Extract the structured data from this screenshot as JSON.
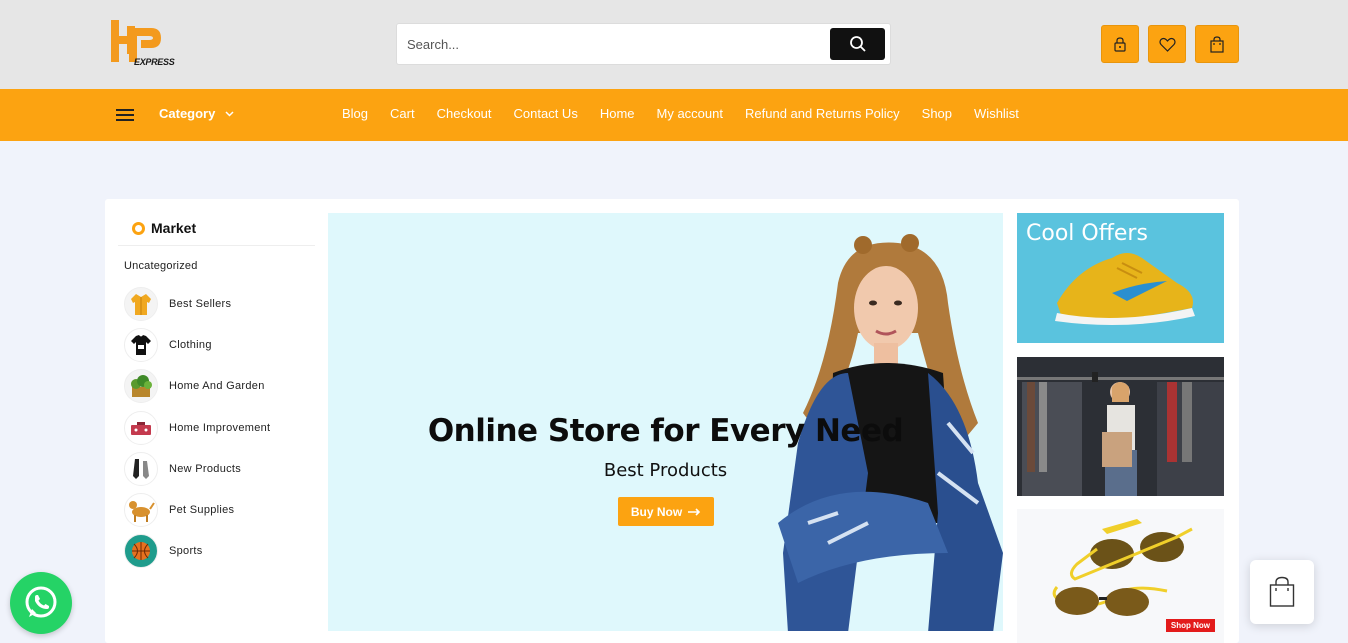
{
  "header": {
    "logo_text": "EXPRESS",
    "search": {
      "placeholder": "Search..."
    },
    "icons": [
      "lock-icon",
      "heart-icon",
      "bag-icon"
    ]
  },
  "nav": {
    "category_label": "Category",
    "menu": [
      "Blog",
      "Cart",
      "Checkout",
      "Contact Us",
      "Home",
      "My account",
      "Refund and Returns Policy",
      "Shop",
      "Wishlist"
    ]
  },
  "sidebar": {
    "title": "Market",
    "uncategorized": "Uncategorized",
    "items": [
      {
        "label": "Best Sellers"
      },
      {
        "label": "Clothing"
      },
      {
        "label": "Home And Garden"
      },
      {
        "label": "Home Improvement"
      },
      {
        "label": "New Products"
      },
      {
        "label": "Pet Supplies"
      },
      {
        "label": "Sports"
      }
    ]
  },
  "hero": {
    "title": "Online Store for Every Need",
    "subtitle": "Best Products",
    "button": "Buy Now"
  },
  "offers": {
    "cool_offers": "Cool Offers",
    "shop_now": "Shop Now"
  },
  "colors": {
    "accent": "#fca311",
    "dark": "#111111",
    "bg": "#f0f3fb"
  }
}
